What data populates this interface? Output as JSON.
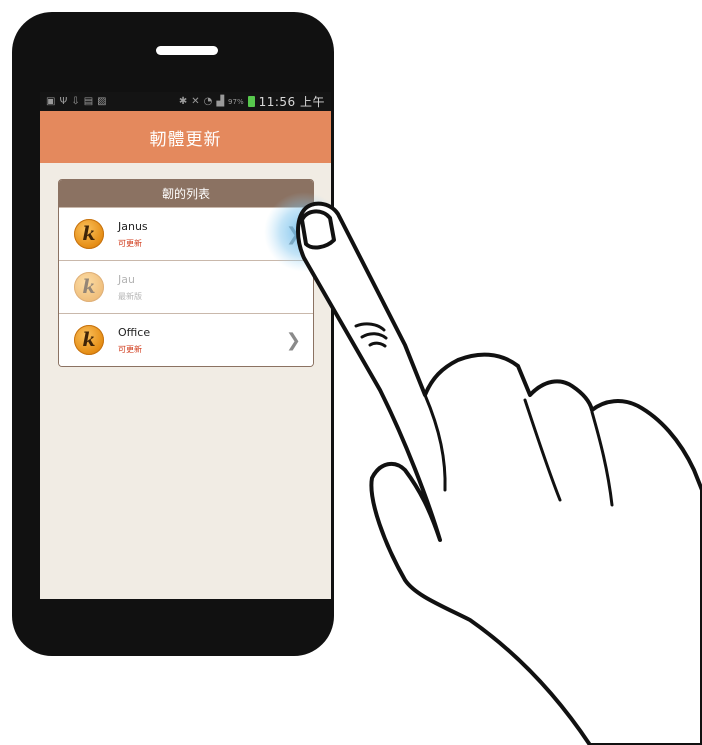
{
  "statusbar": {
    "left_icons": [
      "sd-card-icon",
      "usb-icon",
      "download-icon",
      "image-icon",
      "photo-icon"
    ],
    "battery_pct": "97%",
    "time": "11:56 上午"
  },
  "appbar": {
    "title": "軔體更新"
  },
  "device_list": {
    "header": "韌的列表",
    "items": [
      {
        "name": "Janus",
        "status": "可更新",
        "enabled": true
      },
      {
        "name": "Jau",
        "status": "最新版",
        "enabled": false
      },
      {
        "name": "Office",
        "status": "可更新",
        "enabled": true
      }
    ]
  },
  "colors": {
    "appbar": "#e4895d",
    "panel_header": "#8b7262",
    "screen_bg": "#f1ece4",
    "status_red": "#d03a1a",
    "phone_body": "#111111"
  }
}
